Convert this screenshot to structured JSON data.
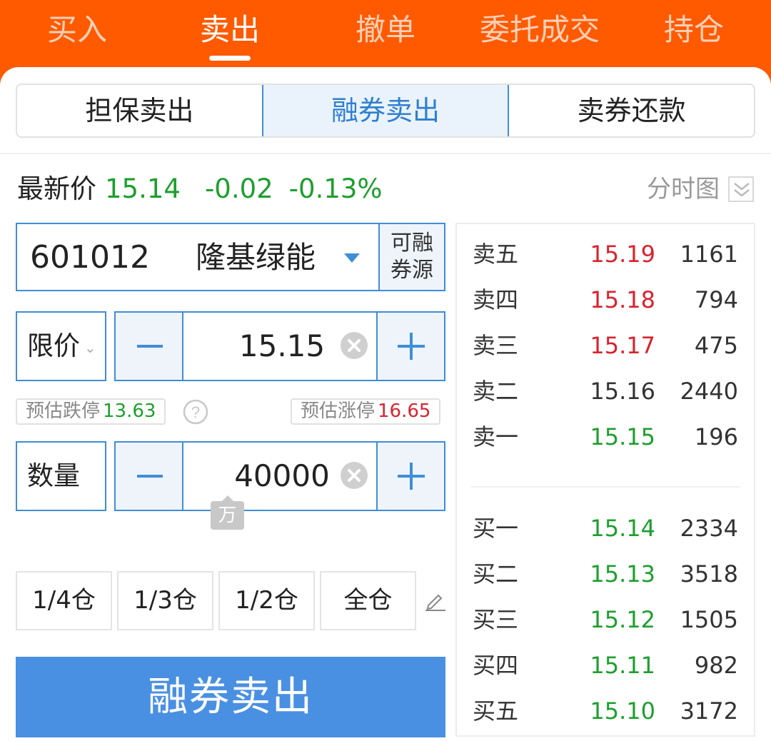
{
  "top_tabs": [
    {
      "label": "买入"
    },
    {
      "label": "卖出"
    },
    {
      "label": "撤单"
    },
    {
      "label": "委托成交"
    },
    {
      "label": "持仓"
    }
  ],
  "active_top_tab": "卖出",
  "segments": [
    {
      "label": "担保卖出"
    },
    {
      "label": "融券卖出"
    },
    {
      "label": "卖券还款"
    }
  ],
  "active_segment": "融券卖出",
  "quote": {
    "label": "最新价",
    "price": "15.14",
    "change": "-0.02",
    "change_pct": "-0.13%"
  },
  "chart_link": {
    "label": "分时图",
    "icon": "chevron-down-double-icon"
  },
  "stock": {
    "code": "601012",
    "name": "隆基绿能",
    "source_button": {
      "line1": "可融",
      "line2": "券源"
    }
  },
  "price_type": {
    "label": "限价"
  },
  "price_input": {
    "value": "15.15"
  },
  "estimates": {
    "limit_down_label": "预估跌停",
    "limit_down_value": "13.63",
    "limit_up_label": "预估涨停",
    "limit_up_value": "16.65"
  },
  "quantity": {
    "label": "数量",
    "value": "40000",
    "unit_tip": "万"
  },
  "position_buttons": [
    {
      "label": "1/4仓"
    },
    {
      "label": "1/3仓"
    },
    {
      "label": "1/2仓"
    },
    {
      "label": "全仓"
    }
  ],
  "submit": {
    "label": "融券卖出"
  },
  "order_book": {
    "asks": [
      {
        "label": "卖五",
        "price": "15.19",
        "volume": "1161",
        "color": "#d9232e"
      },
      {
        "label": "卖四",
        "price": "15.18",
        "volume": "794",
        "color": "#d9232e"
      },
      {
        "label": "卖三",
        "price": "15.17",
        "volume": "475",
        "color": "#d9232e"
      },
      {
        "label": "卖二",
        "price": "15.16",
        "volume": "2440",
        "color": "#333333"
      },
      {
        "label": "卖一",
        "price": "15.15",
        "volume": "196",
        "color": "#1d9f2e"
      }
    ],
    "bids": [
      {
        "label": "买一",
        "price": "15.14",
        "volume": "2334",
        "color": "#1d9f2e"
      },
      {
        "label": "买二",
        "price": "15.13",
        "volume": "3518",
        "color": "#1d9f2e"
      },
      {
        "label": "买三",
        "price": "15.12",
        "volume": "1505",
        "color": "#1d9f2e"
      },
      {
        "label": "买四",
        "price": "15.11",
        "volume": "982",
        "color": "#1d9f2e"
      },
      {
        "label": "买五",
        "price": "15.10",
        "volume": "3172",
        "color": "#1d9f2e"
      }
    ]
  },
  "colors": {
    "brand": "#ff5a00",
    "accent": "#3f8ed6",
    "button": "#4a90e2",
    "up": "#d9232e",
    "down": "#1d9f2e"
  }
}
